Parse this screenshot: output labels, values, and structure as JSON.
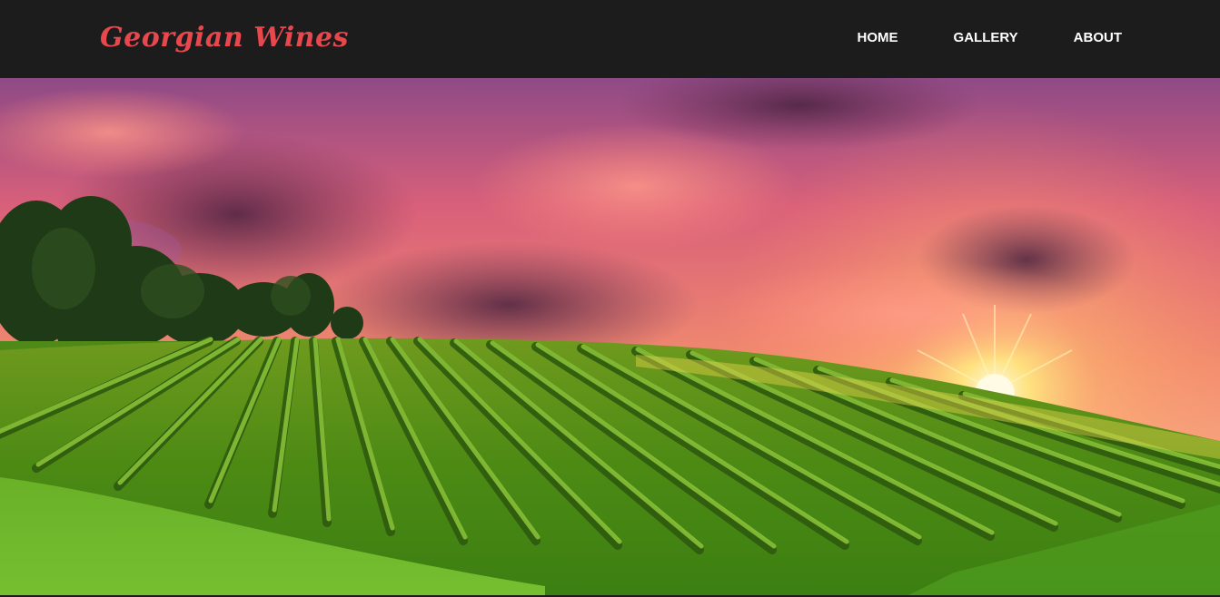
{
  "header": {
    "brand": "Georgian Wines",
    "nav": [
      {
        "label": "HOME"
      },
      {
        "label": "GALLERY"
      },
      {
        "label": "ABOUT"
      }
    ]
  },
  "hero": {
    "image": "vineyard-sunset-image"
  },
  "colors": {
    "header_bg": "#1c1c1c",
    "brand": "#e8474d",
    "nav_text": "#ffffff"
  }
}
